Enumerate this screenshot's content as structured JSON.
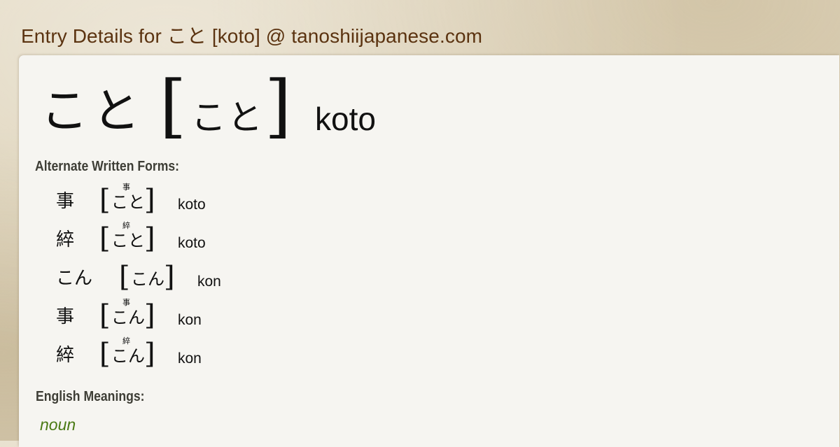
{
  "page": {
    "title": "Entry Details for こと [koto] @ tanoshiijapanese.com"
  },
  "headword": {
    "word": "こと",
    "bracket_open": "[",
    "reading": "こと",
    "bracket_close": "]",
    "romaji": "koto"
  },
  "alternate_forms": {
    "label": "Alternate Written Forms:",
    "items": [
      {
        "word": "事",
        "ruby": "事",
        "kana": "こと",
        "romaji": "koto"
      },
      {
        "word": "綷",
        "ruby": "綷",
        "kana": "こと",
        "romaji": "koto"
      },
      {
        "word": "こん",
        "ruby": "",
        "kana": "こん",
        "romaji": "kon"
      },
      {
        "word": "事",
        "ruby": "事",
        "kana": "こん",
        "romaji": "kon"
      },
      {
        "word": "綷",
        "ruby": "綷",
        "kana": "こん",
        "romaji": "kon"
      }
    ]
  },
  "english_meanings": {
    "label": "English Meanings:",
    "part_of_speech": "noun"
  },
  "colors": {
    "title": "#5b3310",
    "panel_bg": "#f6f5f1",
    "section_label": "#3e3e36",
    "part_of_speech": "#4a7a14"
  }
}
